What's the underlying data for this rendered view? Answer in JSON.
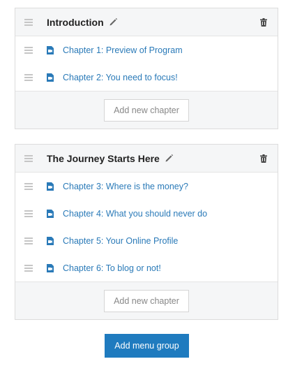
{
  "groups": [
    {
      "title": "Introduction",
      "chapters": [
        {
          "label": "Chapter 1:  Preview of Program"
        },
        {
          "label": "Chapter 2:  You need to focus!"
        }
      ],
      "add_chapter_label": "Add new chapter"
    },
    {
      "title": "The Journey Starts Here",
      "chapters": [
        {
          "label": "Chapter 3:  Where is the money?"
        },
        {
          "label": "Chapter 4:  What you should never do"
        },
        {
          "label": "Chapter 5:  Your Online Profile"
        },
        {
          "label": "Chapter 6:  To blog or not!"
        }
      ],
      "add_chapter_label": "Add new chapter"
    }
  ],
  "add_group_label": "Add menu group",
  "colors": {
    "link": "#2a7ab8",
    "primary_button": "#1f7bbf",
    "panel_bg": "#f5f6f7"
  },
  "icons": {
    "drag": "drag-handle-icon",
    "edit": "pencil-icon",
    "delete": "trash-icon",
    "chapter": "video-file-icon"
  }
}
